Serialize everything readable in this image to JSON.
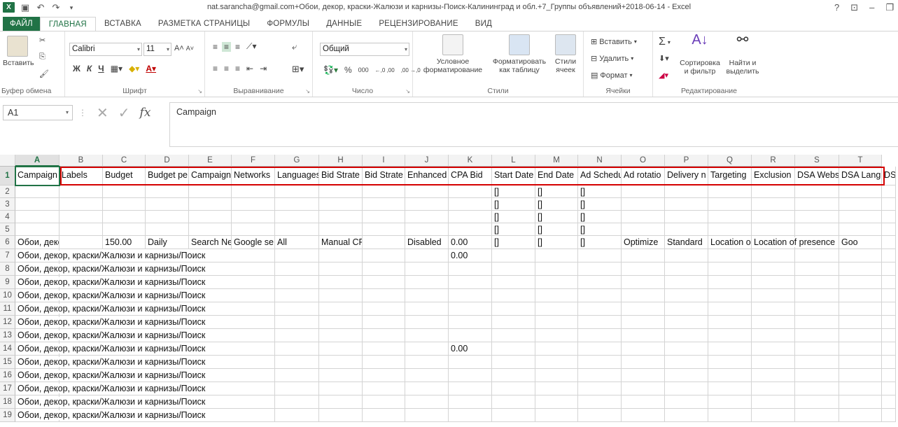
{
  "title_bar": {
    "app_icon": "excel-icon",
    "document_title": "nat.sarancha@gmail.com+Обои, декор, краски-Жалюзи и карнизы-Поиск-Калининград и обл.+7_Группы объявлений+2018-06-14 - Excel",
    "help": "?",
    "ribbon_display": "⊡",
    "minimize": "–",
    "restore": "❐"
  },
  "tabs": [
    "ФАЙЛ",
    "ГЛАВНАЯ",
    "ВСТАВКА",
    "РАЗМЕТКА СТРАНИЦЫ",
    "ФОРМУЛЫ",
    "ДАННЫЕ",
    "РЕЦЕНЗИРОВАНИЕ",
    "ВИД"
  ],
  "active_tab": "ГЛАВНАЯ",
  "ribbon": {
    "clipboard": {
      "paste": "Вставить",
      "label": "Буфер обмена"
    },
    "font": {
      "name": "Calibri",
      "size": "11",
      "bold": "Ж",
      "italic": "К",
      "underline": "Ч",
      "label": "Шрифт"
    },
    "alignment": {
      "label": "Выравнивание"
    },
    "number": {
      "format": "Общий",
      "percent": "%",
      "thousands": "000",
      "inc_dec": "←,0 ,00",
      "dec_dec": ",00 →,0",
      "label": "Число"
    },
    "styles": {
      "conditional": "Условное форматирование",
      "as_table": "Форматировать как таблицу",
      "cell_styles": "Стили ячеек",
      "label": "Стили"
    },
    "cells": {
      "insert": "Вставить",
      "delete": "Удалить",
      "format": "Формат",
      "label": "Ячейки"
    },
    "editing": {
      "sort": "Сортировка и фильтр",
      "find": "Найти и выделить",
      "label": "Редактирование"
    }
  },
  "formula_bar": {
    "name_box": "A1",
    "fx": "fx",
    "content": "Campaign"
  },
  "columns": [
    "A",
    "B",
    "C",
    "D",
    "E",
    "F",
    "G",
    "H",
    "I",
    "J",
    "K",
    "L",
    "M",
    "N",
    "O",
    "P",
    "Q",
    "R",
    "S",
    "T"
  ],
  "rows": [
    "1",
    "2",
    "3",
    "4",
    "5",
    "6",
    "7",
    "8",
    "9",
    "10",
    "11",
    "12",
    "13",
    "14",
    "15",
    "16",
    "17",
    "18",
    "19"
  ],
  "cells": {
    "r1": [
      "Campaign",
      "Labels",
      "Budget",
      "Budget pe",
      "Campaign",
      "Networks",
      "Languages",
      "Bid Strate",
      "Bid Strate",
      "Enhanced",
      "CPA Bid",
      "Start Date",
      "End Date",
      "Ad Schedu",
      "Ad rotatio",
      "Delivery n",
      "Targeting",
      "Exclusion",
      "DSA Webs",
      "DSA Langu",
      "DSA"
    ],
    "bracket": "[]",
    "r6": {
      "A": "Обои, декор, краски",
      "C": "150.00",
      "D": "Daily",
      "E": "Search Ne",
      "F": "Google se",
      "G": "All",
      "H": "Manual CPC",
      "J": "Disabled",
      "K": "0.00",
      "O": "Optimize",
      "P": "Standard",
      "Q": "Location o",
      "R": "Location of presence",
      "T": "Goo"
    },
    "long_text": "Обои, декор, краски/Жалюзи и карнизы/Поиск",
    "k7": "0.00",
    "k14": "0.00"
  }
}
